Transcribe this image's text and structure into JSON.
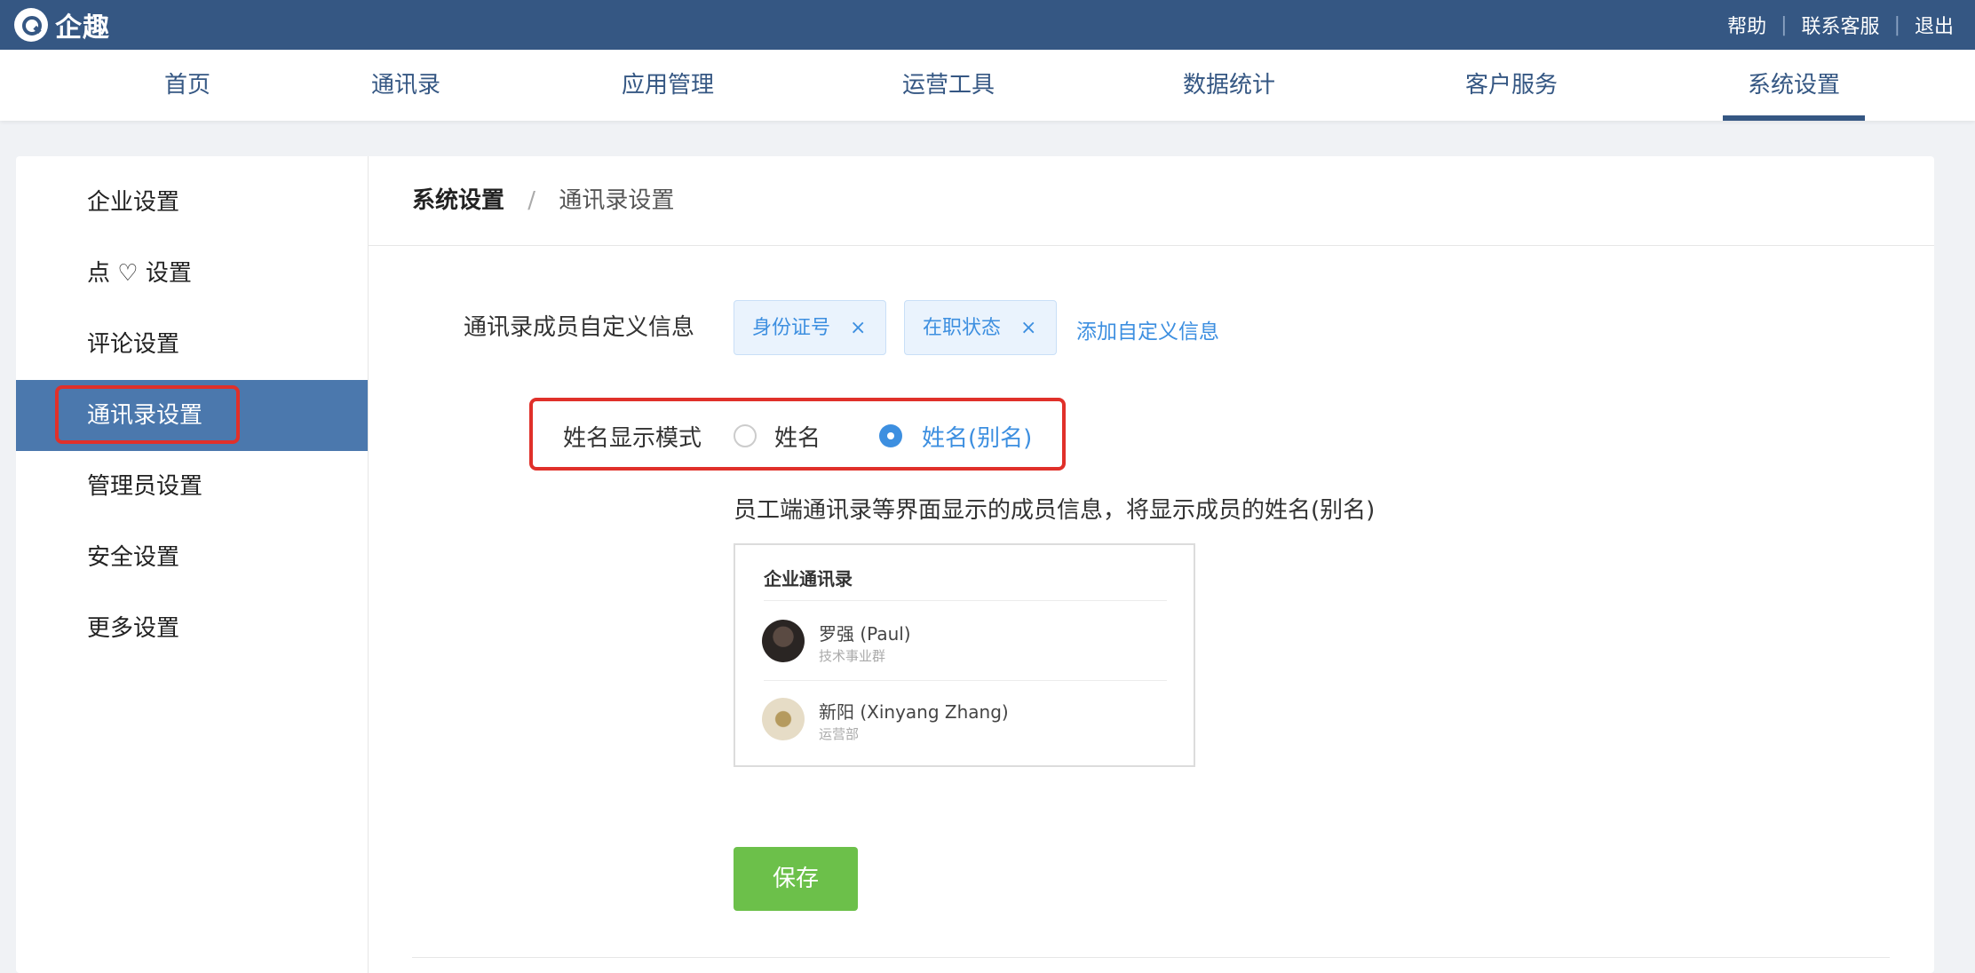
{
  "app": {
    "name": "企趣",
    "logo_icon": "qiqu-logo-icon"
  },
  "top_links": [
    "帮助",
    "联系客服",
    "退出"
  ],
  "nav": {
    "items": [
      "首页",
      "通讯录",
      "应用管理",
      "运营工具",
      "数据统计",
      "客户服务",
      "系统设置"
    ],
    "active": "系统设置"
  },
  "sidebar": {
    "items": [
      "企业设置",
      "点 ♡ 设置",
      "评论设置",
      "通讯录设置",
      "管理员设置",
      "安全设置",
      "更多设置"
    ],
    "active": "通讯录设置"
  },
  "breadcrumb": {
    "root": "系统设置",
    "separator": "/",
    "current": "通讯录设置"
  },
  "custom_info": {
    "label": "通讯录成员自定义信息",
    "tags": [
      {
        "label": "身份证号",
        "close": "×"
      },
      {
        "label": "在职状态",
        "close": "×"
      }
    ],
    "add_link": "添加自定义信息"
  },
  "name_mode": {
    "label": "姓名显示模式",
    "options": [
      {
        "label": "姓名",
        "checked": false
      },
      {
        "label": "姓名(别名)",
        "checked": true
      }
    ],
    "description": "员工端通讯录等界面显示的成员信息，将显示成员的姓名(别名)"
  },
  "preview": {
    "title": "企业通讯录",
    "members": [
      {
        "name": "罗强 (Paul)",
        "dept": "技术事业群"
      },
      {
        "name": "新阳 (Xinyang Zhang)",
        "dept": "运营部"
      }
    ]
  },
  "save_label": "保存",
  "colors": {
    "header": "#355783",
    "accent_blue": "#3d8fe0",
    "active_sidebar": "#4b78ad",
    "highlight_red": "#e0302a",
    "save_green": "#6cc04a"
  }
}
